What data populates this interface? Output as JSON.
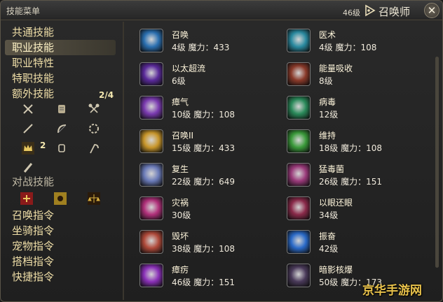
{
  "window": {
    "title": "技能菜单",
    "level": "46级",
    "job": "召唤师",
    "close_glyph": "✕"
  },
  "categories": [
    {
      "label": "共通技能",
      "active": false
    },
    {
      "label": "职业技能",
      "active": true
    },
    {
      "label": "职业特性",
      "active": false
    },
    {
      "label": "特职技能",
      "active": false
    },
    {
      "label": "额外技能",
      "active": false
    }
  ],
  "extra_slots": {
    "fraction": "2/4",
    "count_badge": "2"
  },
  "pvp_label": "对战技能",
  "lower_categories": [
    "召唤指令",
    "坐骑指令",
    "宠物指令",
    "搭档指令",
    "快捷指令"
  ],
  "skills": [
    {
      "name": "召唤",
      "info": "4级 魔力：433",
      "icon": "summon-icon",
      "color": "#2a6fb0"
    },
    {
      "name": "以太超流",
      "info": "6级",
      "icon": "aetherflow-icon",
      "color": "#5a2a9a"
    },
    {
      "name": "瘴气",
      "info": "10级 魔力：108",
      "icon": "miasma-icon",
      "color": "#7a3ab0"
    },
    {
      "name": "召唤II",
      "info": "15级 魔力：433",
      "icon": "summon-ii-icon",
      "color": "#c8962a"
    },
    {
      "name": "复生",
      "info": "22级 魔力：649",
      "icon": "resurrection-icon",
      "color": "#6a7ab8"
    },
    {
      "name": "灾祸",
      "info": "30级",
      "icon": "bane-icon",
      "color": "#b0307a"
    },
    {
      "name": "毁坏",
      "info": "38级 魔力：108",
      "icon": "ruin-icon",
      "color": "#b04a3a"
    },
    {
      "name": "瘴疠",
      "info": "46级 魔力：151",
      "icon": "miasma-ii-icon",
      "color": "#8a30b8"
    },
    {
      "name": "医术",
      "info": "4级 魔力：108",
      "icon": "physick-icon",
      "color": "#2a8aa0"
    },
    {
      "name": "能量吸收",
      "info": "8级",
      "icon": "energy-drain-icon",
      "color": "#8a3a2a"
    },
    {
      "name": "病毒",
      "info": "12级",
      "icon": "virus-icon",
      "color": "#2a8a5a"
    },
    {
      "name": "维持",
      "info": "18级 魔力：108",
      "icon": "sustain-icon",
      "color": "#3a9a3a"
    },
    {
      "name": "猛毒菌",
      "info": "26级 魔力：151",
      "icon": "bio-ii-icon",
      "color": "#9a3a7a"
    },
    {
      "name": "以眼还眼",
      "info": "34级",
      "icon": "eye-for-an-eye-icon",
      "color": "#8a2a4a"
    },
    {
      "name": "振奋",
      "info": "42级",
      "icon": "rouse-icon",
      "color": "#2a6ac8"
    },
    {
      "name": "暗影核爆",
      "info": "50级 魔力：173",
      "icon": "shadow-flare-icon",
      "color": "#4a3a5a"
    }
  ],
  "watermark": "京华手游网"
}
